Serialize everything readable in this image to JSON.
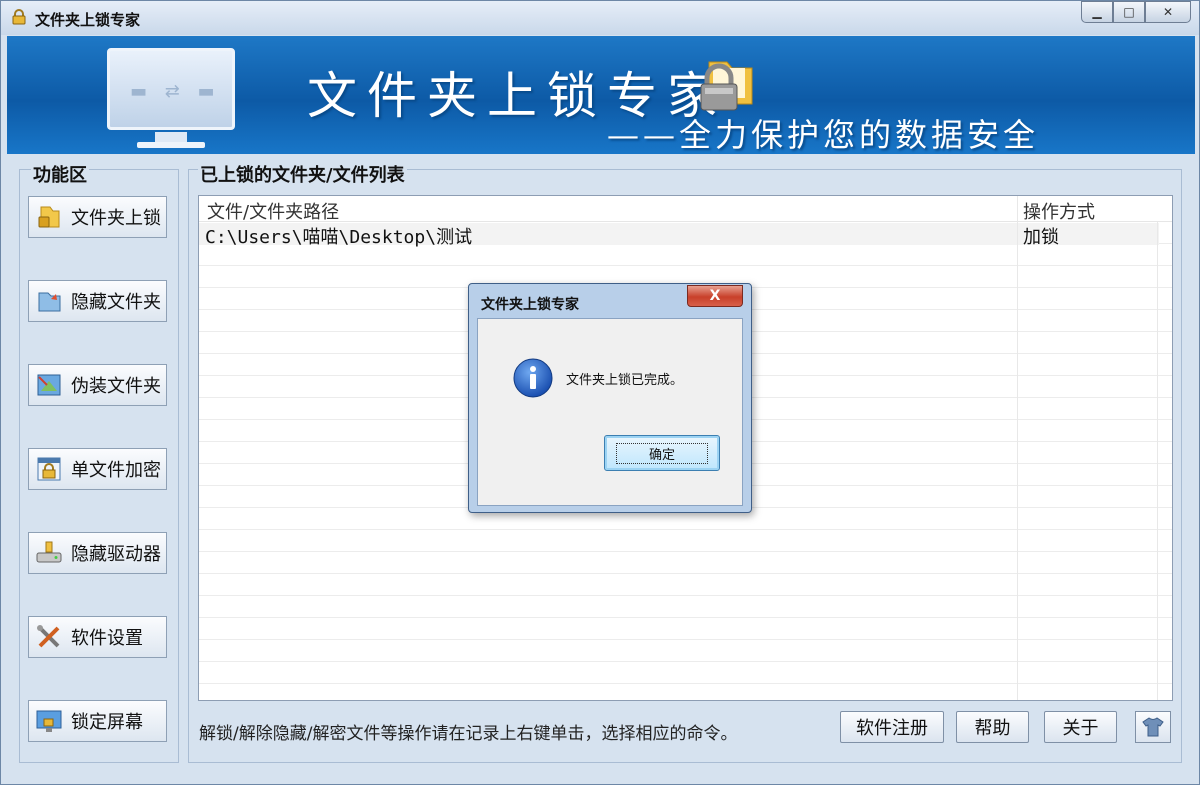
{
  "window": {
    "title": "文件夹上锁专家",
    "controls": [
      "minimize",
      "maximize",
      "close"
    ]
  },
  "banner": {
    "title": "文件夹上锁专家",
    "subtitle": "——全力保护您的数据安全"
  },
  "sidebar": {
    "title": "功能区",
    "items": [
      {
        "label": "文件夹上锁",
        "icon": "folder-lock-icon"
      },
      {
        "label": "隐藏文件夹",
        "icon": "hide-folder-icon"
      },
      {
        "label": "伪装文件夹",
        "icon": "disguise-folder-icon"
      },
      {
        "label": "单文件加密",
        "icon": "file-encrypt-icon"
      },
      {
        "label": "隐藏驱动器",
        "icon": "hide-drive-icon"
      },
      {
        "label": "软件设置",
        "icon": "tools-icon"
      },
      {
        "label": "锁定屏幕",
        "icon": "lock-screen-icon"
      }
    ]
  },
  "main": {
    "title": "已上锁的文件夹/文件列表",
    "columns": [
      "文件/文件夹路径",
      "操作方式"
    ],
    "rows": [
      {
        "path": "C:\\Users\\喵喵\\Desktop\\测试",
        "method": "加锁"
      }
    ],
    "hint": "解锁/解除隐藏/解密文件等操作请在记录上右键单击，选择相应的命令。"
  },
  "footer": {
    "register_label": "软件注册",
    "help_label": "帮助",
    "about_label": "关于",
    "skin_icon": "shirt-icon"
  },
  "dialog": {
    "title": "文件夹上锁专家",
    "message": "文件夹上锁已完成。",
    "ok_label": "确定",
    "close_label": "X"
  }
}
